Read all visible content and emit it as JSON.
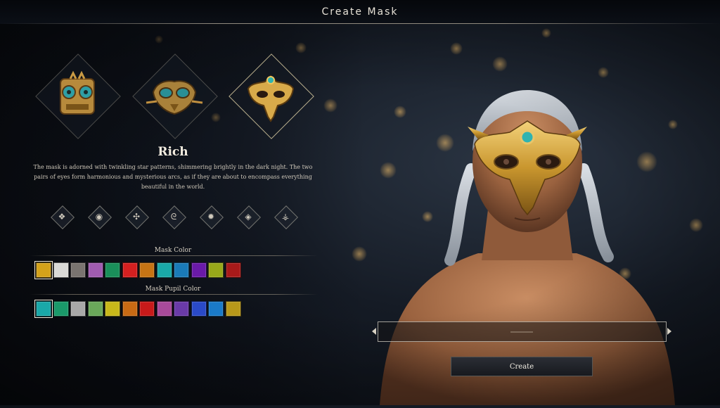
{
  "window": {
    "title": "Create Mask"
  },
  "masks": [
    {
      "name": "tribal-mask",
      "selected": false
    },
    {
      "name": "owl-mask",
      "selected": false
    },
    {
      "name": "eagle-mask",
      "selected": true
    }
  ],
  "selected_mask": {
    "name": "Rich",
    "description": "The mask is adorned with twinkling star patterns, shimmering brightly in the dark night. The two pairs of eyes form harmonious and mysterious arcs, as if they are about to encompass everything beautiful in the world."
  },
  "patterns": [
    {
      "icon": "knot-icon",
      "glyph": "❖"
    },
    {
      "icon": "eye-icon",
      "glyph": "◉"
    },
    {
      "icon": "compass-icon",
      "glyph": "✣"
    },
    {
      "icon": "dragon-icon",
      "glyph": "ᘓ"
    },
    {
      "icon": "sun-icon",
      "glyph": "✹"
    },
    {
      "icon": "gem-icon",
      "glyph": "◈"
    },
    {
      "icon": "tree-icon",
      "glyph": "⚶"
    }
  ],
  "mask_color": {
    "label": "Mask Color",
    "colors": [
      "#d4a21a",
      "#d9d9d6",
      "#7a7470",
      "#a05cb0",
      "#1a8f5a",
      "#d42020",
      "#c67414",
      "#1aa8a8",
      "#1a7ab8",
      "#6a1aa8",
      "#98a81a",
      "#a81a1a"
    ],
    "selected_index": 0
  },
  "mask_pupil_color": {
    "label": "Mask Pupil Color",
    "colors": [
      "#1aa8a8",
      "#1a9a6a",
      "#a8a8a8",
      "#6aa85a",
      "#c8b81a",
      "#c86a14",
      "#c81a1a",
      "#a84a9a",
      "#6a3aa8",
      "#2a4ac8",
      "#1a7ac8",
      "#b8981a"
    ],
    "selected_index": 0
  },
  "name_input": {
    "value": "",
    "placeholder": ""
  },
  "create_button": {
    "label": "Create"
  },
  "colors": {
    "accent_gold": "#c9a23a",
    "frame": "#d2cdc3"
  }
}
